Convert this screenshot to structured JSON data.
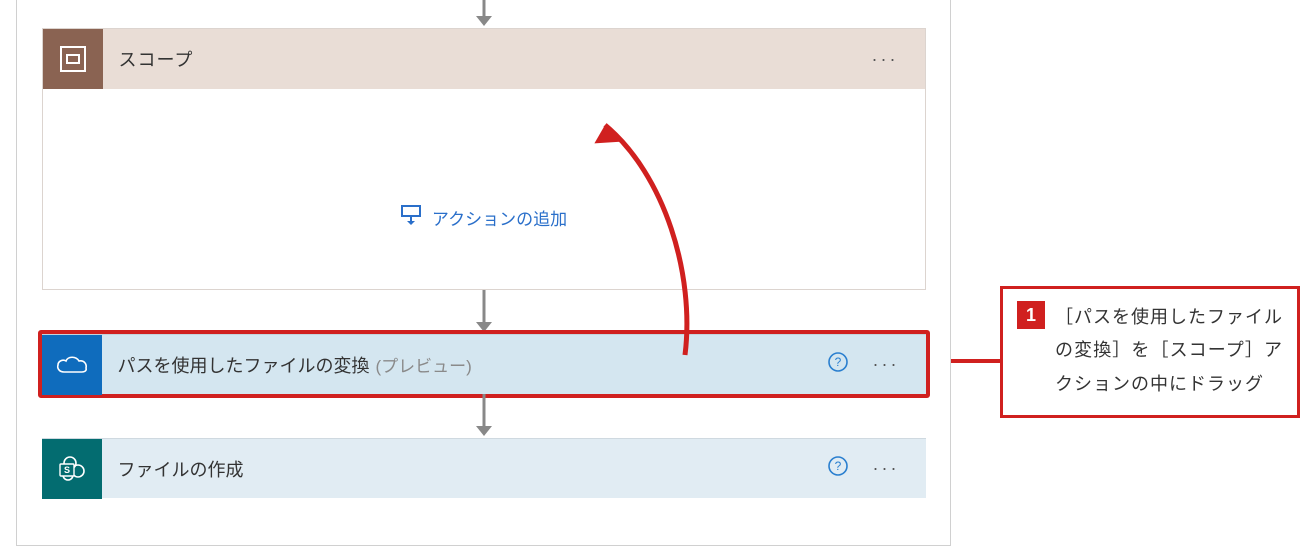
{
  "scope": {
    "title": "スコープ"
  },
  "add_action": {
    "label": "アクションの追加"
  },
  "convert_action": {
    "title": "パスを使用したファイルの変換",
    "preview": "(プレビュー)"
  },
  "create_action": {
    "title": "ファイルの作成"
  },
  "callout": {
    "number": "1",
    "text": "［パスを使用したファイルの変換］を［スコープ］アクションの中にドラッグ"
  }
}
